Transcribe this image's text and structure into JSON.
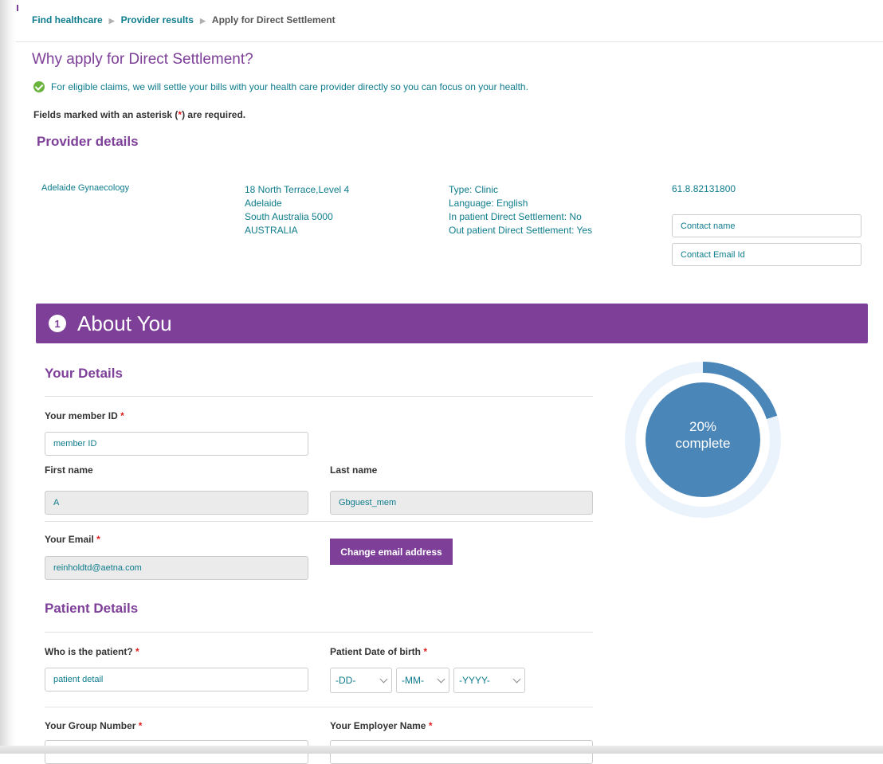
{
  "breadcrumb": {
    "items": [
      "Find healthcare",
      "Provider results"
    ],
    "current": "Apply for Direct Settlement"
  },
  "page": {
    "title": "Why apply for Direct Settlement?",
    "info": "For eligible claims, we will settle your bills with your health care provider directly so you can focus on your health.",
    "required_note_before": "Fields marked with an asterisk (",
    "required_star": "*",
    "required_note_after": ") are required."
  },
  "provider": {
    "heading": "Provider details",
    "name": "Adelaide Gynaecology",
    "address": [
      "18 North Terrace,Level 4",
      "Adelaide",
      "South Australia 5000",
      "AUSTRALIA"
    ],
    "meta": [
      "Type: Clinic",
      "Language: English",
      "In patient Direct Settlement: No",
      "Out patient Direct Settlement: Yes"
    ],
    "phone": "61.8.82131800",
    "contact_name_placeholder": "Contact name",
    "contact_email_placeholder": "Contact Email Id"
  },
  "about": {
    "step": "1",
    "title": "About You"
  },
  "your_details": {
    "heading": "Your Details",
    "member_id_label": "Your member ID",
    "member_id_placeholder": "member ID",
    "first_name_label": "First name",
    "first_name_value": "A",
    "last_name_label": "Last name",
    "last_name_value": "Gbguest_mem",
    "email_label": "Your Email",
    "email_value": "reinholdtd@aetna.com",
    "change_email_button": "Change email address"
  },
  "patient_details": {
    "heading": "Patient Details",
    "who_label": "Who is the patient?",
    "who_placeholder": "patient detail",
    "dob_label": "Patient Date of birth",
    "dob_day": "-DD-",
    "dob_month": "-MM-",
    "dob_year": "-YYYY-",
    "group_label": "Your Group Number",
    "employer_label": "Your Employer Name"
  },
  "progress": {
    "percent": 20,
    "line1": "20%",
    "line2": "complete",
    "color": "#4a86b8",
    "track_color": "#eaf3fb"
  },
  "colors": {
    "brand": "#7d3f98",
    "link": "#0e7c8c",
    "success": "#6ab43e",
    "required": "#e01b1b"
  }
}
